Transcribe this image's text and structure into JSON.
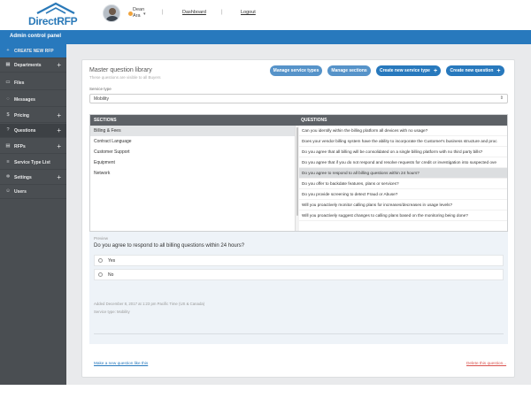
{
  "header": {
    "logo_text": "DirectRFP",
    "user": {
      "first": "Dean",
      "last": "Ara"
    },
    "links": {
      "dashboard": "Dashboard",
      "logout": "Logout"
    },
    "separator": "|"
  },
  "bluebar": {
    "title": "Admin control panel"
  },
  "sidebar": {
    "items": [
      {
        "label": "CREATE NEW RFP",
        "icon": "plus-icon",
        "glyph": "+",
        "plus": ""
      },
      {
        "label": "Departments",
        "icon": "building-icon",
        "glyph": "▦",
        "plus": "+"
      },
      {
        "label": "Files",
        "icon": "file-icon",
        "glyph": "▭",
        "plus": ""
      },
      {
        "label": "Messages",
        "icon": "chat-icon",
        "glyph": "◌",
        "plus": ""
      },
      {
        "label": "Pricing",
        "icon": "dollar-icon",
        "glyph": "$",
        "plus": "+"
      },
      {
        "label": "Questions",
        "icon": "question-icon",
        "glyph": "?",
        "plus": "+"
      },
      {
        "label": "RFPs",
        "icon": "doc-icon",
        "glyph": "▤",
        "plus": "+"
      },
      {
        "label": "Service Type List",
        "icon": "list-icon",
        "glyph": "≡",
        "plus": ""
      },
      {
        "label": "Settings",
        "icon": "gear-icon",
        "glyph": "✲",
        "plus": "+"
      },
      {
        "label": "Users",
        "icon": "users-icon",
        "glyph": "☺",
        "plus": ""
      }
    ]
  },
  "library": {
    "title": "Master question library",
    "subtitle": "These questions are visible to all Buyers",
    "buttons": {
      "manage_service_types": "Manage service types",
      "manage_sections": "Manage sections",
      "create_service_type": "Create new service type",
      "create_question": "Create new question"
    },
    "service_type_label": "Service type",
    "service_type_value": "Mobility"
  },
  "table": {
    "sections_header": "SECTIONS",
    "questions_header": "QUESTIONS",
    "sections": [
      "Billing & Fees",
      "Contract Language",
      "Customer Support",
      "Equipment",
      "Network"
    ],
    "selected_section": 0,
    "questions": [
      "Can you identify within the billing platform all devices with no usage?",
      "Does your vendor billing system have the ability to incorporate the Customer's business structure and proc",
      "Do you agree that all billing will be consolidated on a single billing platform with no third party bills?",
      "Do you agree that if you do not respond and resolve requests for credit or investigation into suspected ove",
      "Do you agree to respond to all billing questions within 24 hours?",
      "Do you offer to backdate features, plans or services?",
      "Do you provide screening to detect Fraud or Abuse?",
      "Will you proactively monitor calling plans for increases/decreases in usage levels?",
      "Will you proactively suggest changes to calling plans based on the monitoring being done?"
    ],
    "selected_question": 4
  },
  "preview": {
    "label": "Preview",
    "question": "Do you agree to respond to all billing questions within 24 hours?",
    "options": [
      "Yes",
      "No"
    ],
    "added": "Added December 8, 2017 at 1:23 pm Pacific Time (US & Canada)",
    "service_type": "Service type: Mobility"
  },
  "footer_links": {
    "make_new": "Make a new question like this",
    "delete": "Delete this question..."
  }
}
